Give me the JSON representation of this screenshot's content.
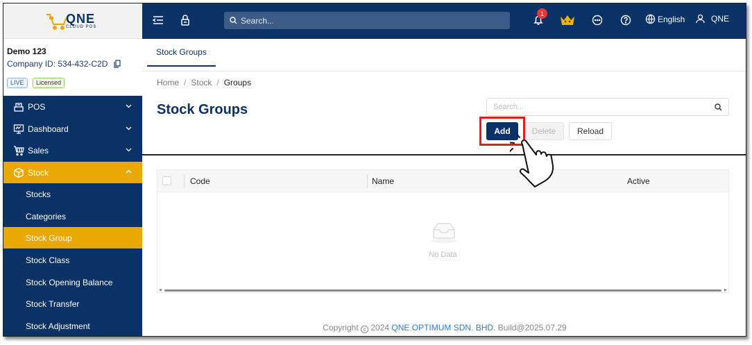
{
  "brand": {
    "logo_top": "QNE",
    "logo_sub": "CLOUD POS"
  },
  "company": {
    "name": "Demo 123",
    "id_text": "Company ID: 534-432-C2D",
    "tag_live": "LIVE",
    "tag_licensed": "Licensed"
  },
  "topbar": {
    "search_placeholder": "Search...",
    "notification_count": "1",
    "language": "English",
    "user": "QNE"
  },
  "sidebar": {
    "items": [
      {
        "label": "POS",
        "icon": "pos-icon",
        "expanded": false
      },
      {
        "label": "Dashboard",
        "icon": "dashboard-icon",
        "expanded": false
      },
      {
        "label": "Sales",
        "icon": "sales-icon",
        "expanded": false
      },
      {
        "label": "Stock",
        "icon": "cube-icon",
        "expanded": true,
        "active": true
      }
    ],
    "stock_sub": [
      "Stocks",
      "Categories",
      "Stock Group",
      "Stock Class",
      "Stock Opening Balance",
      "Stock Transfer",
      "Stock Adjustment"
    ],
    "active_sub": "Stock Group"
  },
  "tabs": [
    "Stock Groups"
  ],
  "breadcrumb": [
    "Home",
    "Stock",
    "Groups"
  ],
  "page": {
    "title": "Stock Groups",
    "search_placeholder": "Search...",
    "buttons": {
      "add": "Add",
      "delete": "Delete",
      "reload": "Reload"
    }
  },
  "table": {
    "columns": [
      "Code",
      "Name",
      "Active"
    ],
    "empty_text": "No Data"
  },
  "footer": {
    "copyright": "Copyright",
    "year": "2024",
    "company": "QNE OPTIMUM SDN. BHD.",
    "build": "Build@2025.07.29"
  },
  "colors": {
    "navy": "#0b3266",
    "accent": "#e8a800",
    "highlight": "#e02020"
  }
}
